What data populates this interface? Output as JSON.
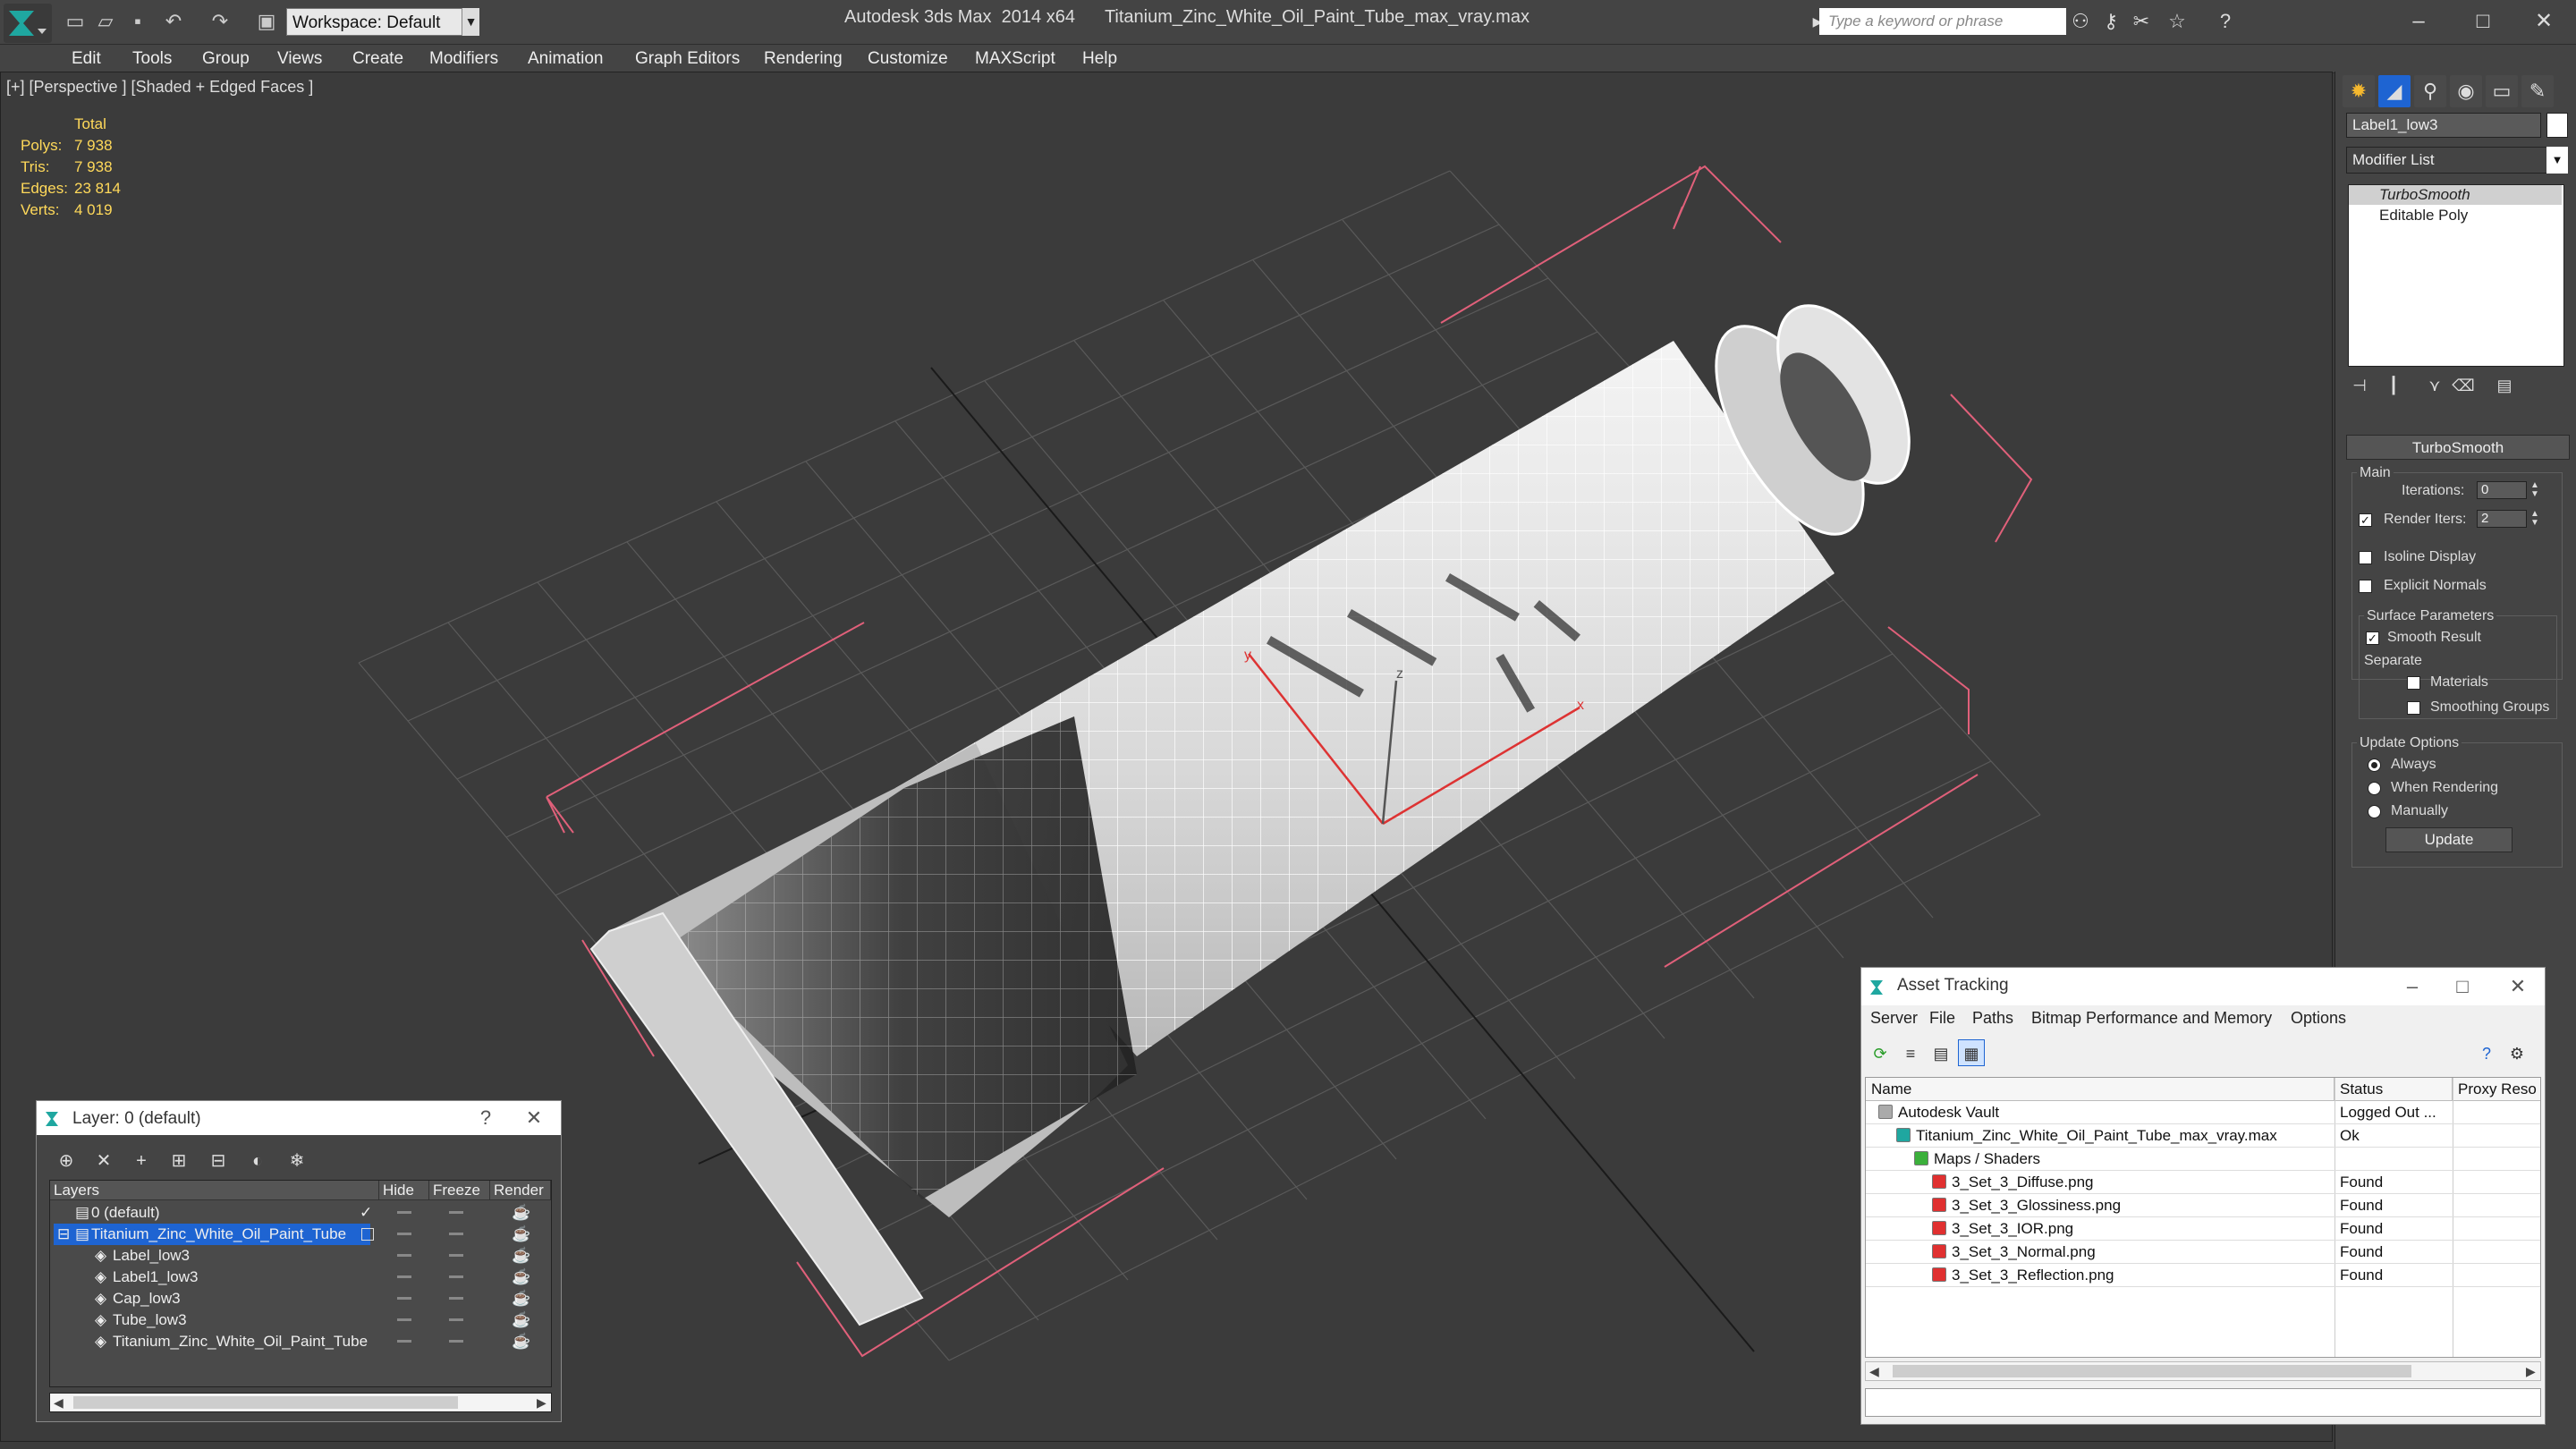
{
  "titlebar": {
    "app": "Autodesk 3ds Max  2014 x64",
    "file": "Titanium_Zinc_White_Oil_Paint_Tube_max_vray.max",
    "workspace": "Workspace: Default",
    "search_placeholder": "Type a keyword or phrase"
  },
  "menu": [
    "Edit",
    "Tools",
    "Group",
    "Views",
    "Create",
    "Modifiers",
    "Animation",
    "Graph Editors",
    "Rendering",
    "Customize",
    "MAXScript",
    "Help"
  ],
  "viewport": {
    "label": "[+] [Perspective ] [Shaded + Edged Faces ]",
    "stats": {
      "header": "Total",
      "rows": [
        {
          "label": "Polys:",
          "value": "7 938"
        },
        {
          "label": "Tris:",
          "value": "7 938"
        },
        {
          "label": "Edges:",
          "value": "23 814"
        },
        {
          "label": "Verts:",
          "value": "4 019"
        }
      ]
    },
    "gizmo_x": "x",
    "gizmo_y": "y",
    "gizmo_z": "z"
  },
  "command_panel": {
    "object_name": "Label1_low3",
    "modifier_list": "Modifier List",
    "stack": [
      "TurboSmooth",
      "Editable Poly"
    ],
    "rollout": {
      "title": "TurboSmooth",
      "main_label": "Main",
      "iterations_label": "Iterations:",
      "iterations_value": "0",
      "render_iters_label": "Render Iters:",
      "render_iters_value": "2",
      "render_iters_checked": true,
      "isoline": "Isoline Display",
      "explicit_normals": "Explicit Normals",
      "surface_params": "Surface Parameters",
      "smooth_result": "Smooth Result",
      "separate": "Separate",
      "materials": "Materials",
      "smoothing_groups": "Smoothing Groups",
      "update_options": "Update Options",
      "always": "Always",
      "when_rendering": "When Rendering",
      "manually": "Manually",
      "update_button": "Update"
    }
  },
  "asset_tracking": {
    "title": "Asset Tracking",
    "menu": [
      "Server",
      "File",
      "Paths",
      "Bitmap Performance and Memory",
      "Options"
    ],
    "columns": [
      "Name",
      "Status",
      "Proxy Reso"
    ],
    "rows": [
      {
        "name": "Autodesk Vault",
        "status": "Logged Out ..."
      },
      {
        "name": "Titanium_Zinc_White_Oil_Paint_Tube_max_vray.max",
        "status": "Ok"
      },
      {
        "name": "Maps / Shaders",
        "status": ""
      },
      {
        "name": "3_Set_3_Diffuse.png",
        "status": "Found"
      },
      {
        "name": "3_Set_3_Glossiness.png",
        "status": "Found"
      },
      {
        "name": "3_Set_3_IOR.png",
        "status": "Found"
      },
      {
        "name": "3_Set_3_Normal.png",
        "status": "Found"
      },
      {
        "name": "3_Set_3_Reflection.png",
        "status": "Found"
      }
    ]
  },
  "layers": {
    "title": "Layer: 0 (default)",
    "help": "?",
    "columns": [
      "Layers",
      "Hide",
      "Freeze",
      "Render"
    ],
    "rows": [
      {
        "name": "0 (default)"
      },
      {
        "name": "Titanium_Zinc_White_Oil_Paint_Tube"
      },
      {
        "name": "Label_low3"
      },
      {
        "name": "Label1_low3"
      },
      {
        "name": "Cap_low3"
      },
      {
        "name": "Tube_low3"
      },
      {
        "name": "Titanium_Zinc_White_Oil_Paint_Tube"
      }
    ]
  },
  "colors": {
    "stats_yellow": "#ffd95a",
    "selection_blue": "#1e64d2",
    "bbox_pink": "#e0607a"
  }
}
